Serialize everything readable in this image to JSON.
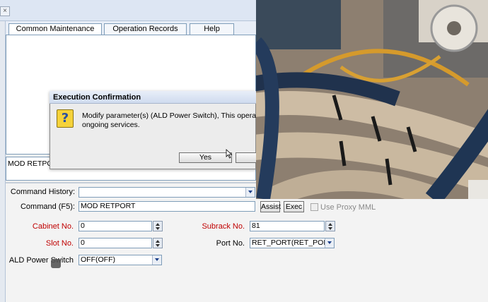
{
  "window": {
    "close_glyph": "×"
  },
  "tabs": [
    {
      "label": "Common Maintenance (Alt+C)",
      "active": true
    },
    {
      "label": "Operation Records (Alt+R)",
      "active": false
    },
    {
      "label": "Help (Alt+N)",
      "active": false
    }
  ],
  "dialog": {
    "title": "Execution Confirmation",
    "icon_glyph": "?",
    "message_line1": "Modify parameter(s) (ALD Power Switch), This operation affe",
    "message_line2": "ongoing services.",
    "yes_label": "Yes"
  },
  "output": {
    "text": "MOD RETPORT"
  },
  "form": {
    "command_history_label": "Command History:",
    "command_history_value": "",
    "command_label": "Command (F5):",
    "command_value": "MOD RETPORT",
    "assist_label": "Assist",
    "exec_label": "Exec",
    "proxy_label": "Use Proxy MML",
    "cabinet_label": "Cabinet No.",
    "cabinet_value": "0",
    "subrack_label": "Subrack No.",
    "subrack_value": "81",
    "slot_label": "Slot No.",
    "slot_value": "0",
    "port_label": "Port No.",
    "port_value": "RET_PORT(RET_PORT)",
    "ald_label": "ALD Power Switch",
    "ald_value": "OFF(OFF)"
  },
  "colors": {
    "required_label": "#c00000",
    "tab_border": "#7f9db9"
  }
}
